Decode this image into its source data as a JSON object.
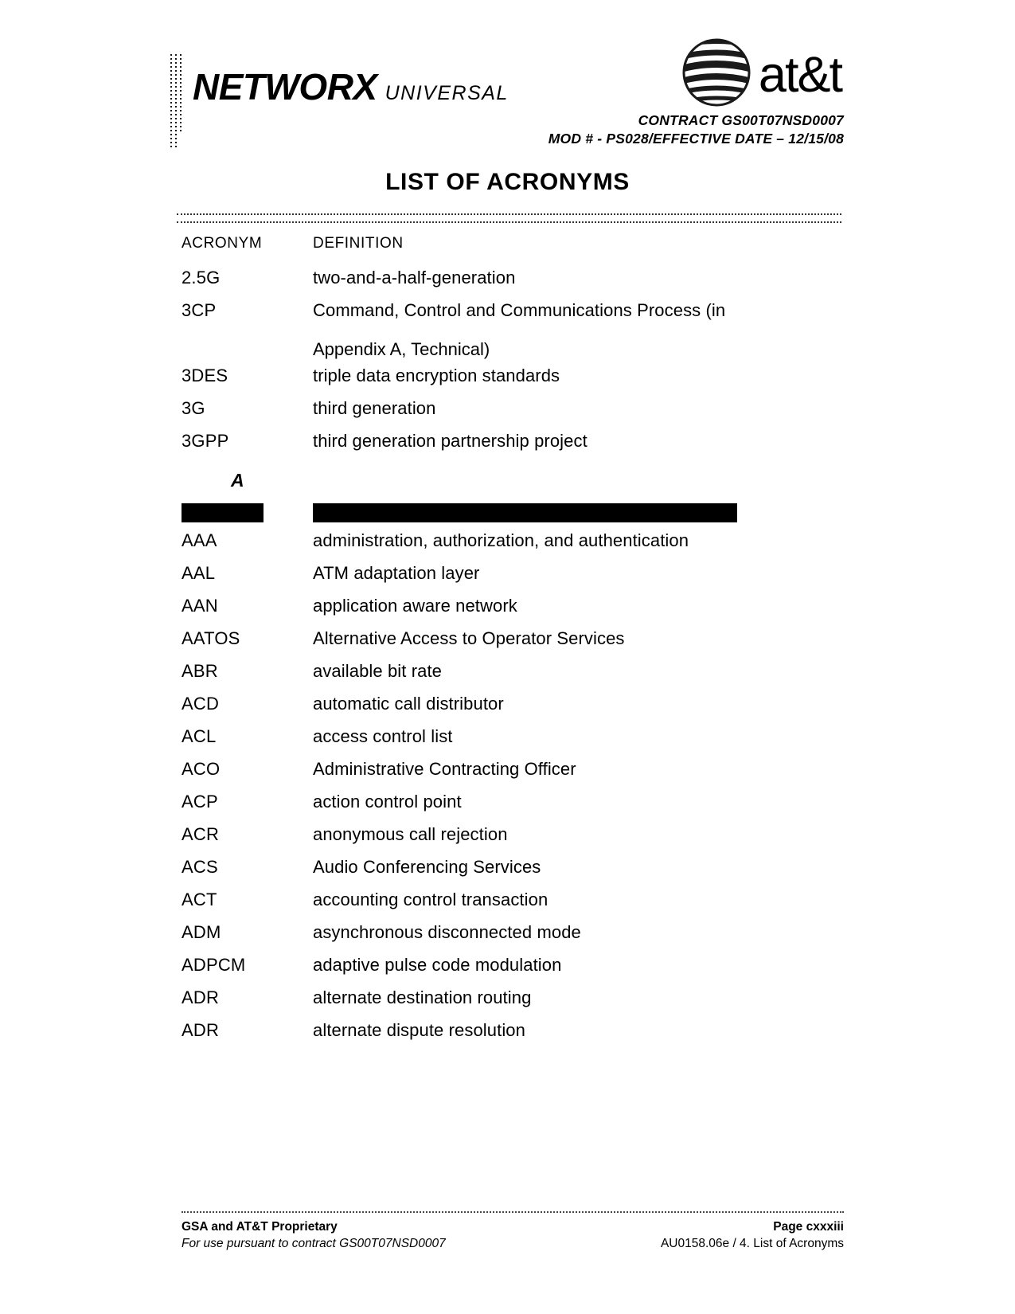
{
  "header": {
    "logo_primary": "NETWORX",
    "logo_secondary": "UNIVERSAL",
    "brand_name": "at&t",
    "brand_globe_icon": "att-globe-icon",
    "contract_line": "CONTRACT GS00T07NSD0007",
    "mod_line": "MOD # - PS028/EFFECTIVE DATE – 12/15/08"
  },
  "title": "LIST OF ACRONYMS",
  "table": {
    "headers": {
      "acronym": "ACRONYM",
      "definition": "DEFINITION"
    },
    "rows": [
      {
        "acronym": "2.5G",
        "definition": "two-and-a-half-generation"
      },
      {
        "acronym": "3CP",
        "definition": "Command, Control and Communications Process  (in",
        "continuation": "Appendix A, Technical)"
      },
      {
        "acronym": "3DES",
        "definition": "triple data encryption standards"
      },
      {
        "acronym": "3G",
        "definition": "third generation"
      },
      {
        "acronym": "3GPP",
        "definition": "third generation partnership project"
      }
    ],
    "section_letter": "A",
    "redaction_bar_acronym": "",
    "redaction_bar_definition": "",
    "rows_a": [
      {
        "acronym": "AAA",
        "definition": "administration, authorization, and authentication"
      },
      {
        "acronym": "AAL",
        "definition": "ATM adaptation layer"
      },
      {
        "acronym": "AAN",
        "definition": "application aware network"
      },
      {
        "acronym": "AATOS",
        "definition": "Alternative Access to Operator Services"
      },
      {
        "acronym": "ABR",
        "definition": "available bit rate"
      },
      {
        "acronym": "ACD",
        "definition": "automatic call distributor"
      },
      {
        "acronym": "ACL",
        "definition": "access control list"
      },
      {
        "acronym": "ACO",
        "definition": "Administrative Contracting Officer"
      },
      {
        "acronym": "ACP",
        "definition": "action control point"
      },
      {
        "acronym": "ACR",
        "definition": "anonymous call rejection"
      },
      {
        "acronym": "ACS",
        "definition": "Audio Conferencing Services"
      },
      {
        "acronym": "ACT",
        "definition": "accounting control transaction"
      },
      {
        "acronym": "ADM",
        "definition": "asynchronous disconnected mode"
      },
      {
        "acronym": "ADPCM",
        "definition": "adaptive pulse code modulation"
      },
      {
        "acronym": "ADR",
        "definition": "alternate destination routing"
      },
      {
        "acronym": "ADR",
        "definition": "alternate dispute resolution"
      }
    ]
  },
  "footer": {
    "proprietary": "GSA and AT&T Proprietary",
    "page_label": "Page cxxxiii",
    "use_clause": "For use pursuant to contract GS00T07NSD0007",
    "doc_ref": "AU0158.06e / 4. List of Acronyms"
  }
}
